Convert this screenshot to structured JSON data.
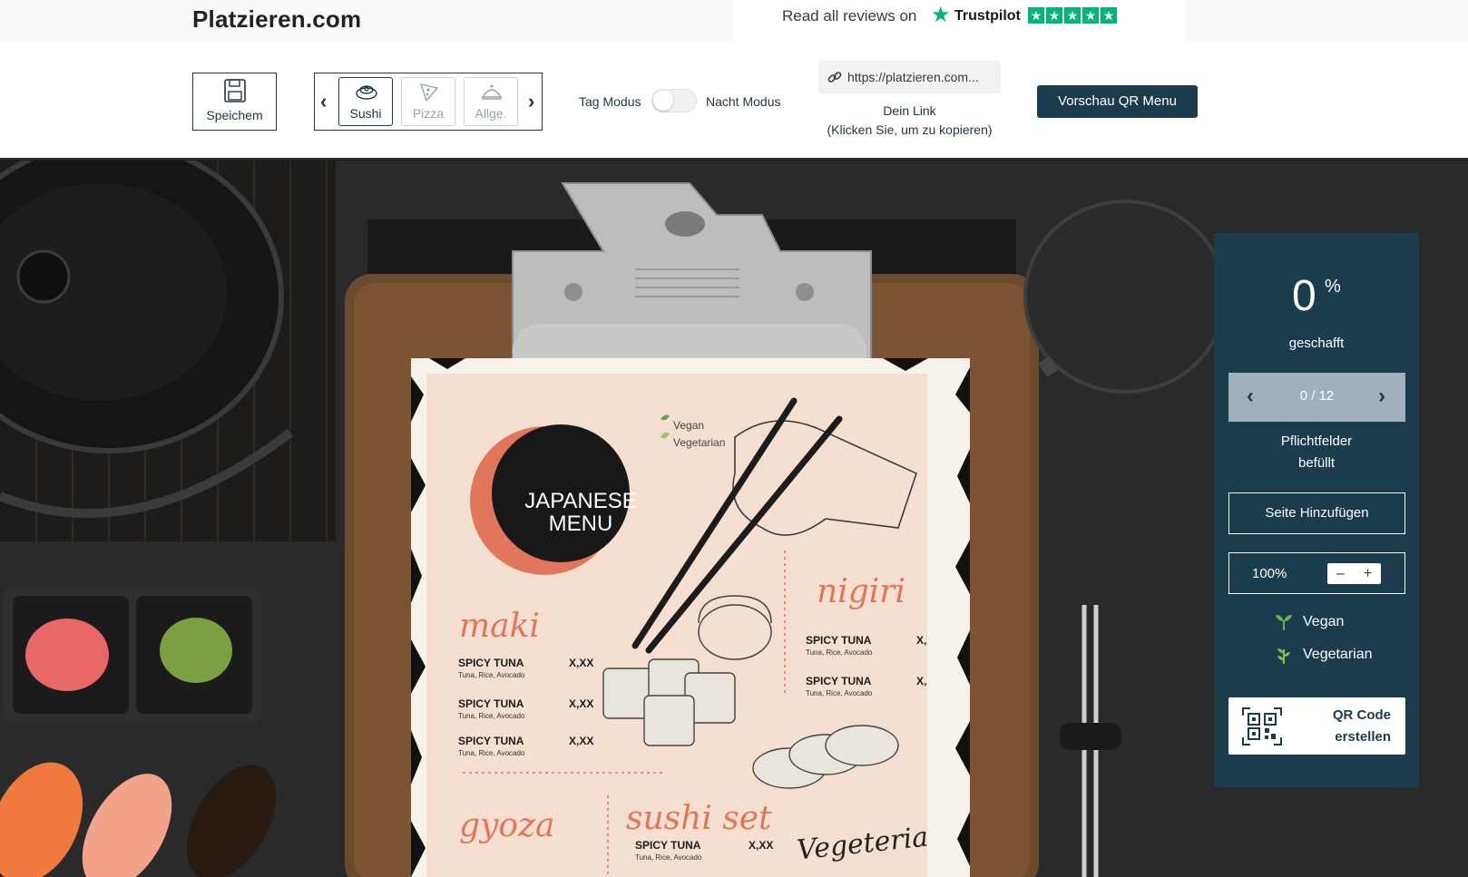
{
  "brand": "Platzieren.com",
  "reviews": {
    "text": "Read all reviews on",
    "provider": "Trustpilot",
    "stars": [
      "★",
      "★",
      "★",
      "★",
      "★"
    ]
  },
  "toolbar": {
    "save_label": "Speichem",
    "categories": [
      {
        "label": "Sushi",
        "active": true,
        "icon": "sushi-icon"
      },
      {
        "label": "Pizza",
        "active": false,
        "icon": "pizza-icon"
      },
      {
        "label": "Allge.",
        "active": false,
        "icon": "cloche-icon"
      }
    ],
    "mode_day": "Tag Modus",
    "mode_night": "Nacht Modus",
    "link_url": "https://platzieren.com...",
    "link_caption": "Dein Link",
    "link_hint": "(Klicken Sie, um zu kopieren)",
    "preview_label": "Vorschau QR Menu"
  },
  "menu": {
    "title_line1": "JAPANESE",
    "title_line2": "MENU",
    "legend_vegan": "Vegan",
    "legend_vegetarian": "Vegetarian",
    "sections": {
      "maki": "maki",
      "nigiri": "nigiri",
      "gyoza": "gyoza",
      "sushi_set": "sushi set",
      "vegetarian": "Vegeterian"
    },
    "item_name": "SPICY TUNA",
    "item_desc": "Tuna, Rice, Avocado",
    "item_price": "X,XX"
  },
  "panel": {
    "percent": "0",
    "percent_symbol": "%",
    "progress_label": "geschafft",
    "pager": "0 / 12",
    "required_line1": "Pflichtfelder",
    "required_line2": "befüllt",
    "add_page": "Seite Hinzufügen",
    "zoom": "100%",
    "zoom_minus": "–",
    "zoom_plus": "+",
    "legend_vegan": "Vegan",
    "legend_vegetarian": "Vegetarian",
    "qr_line1": "QR Code",
    "qr_line2": "erstellen"
  },
  "colors": {
    "panel": "#1b3c4d",
    "accent_salmon": "#e2765c",
    "trustpilot": "#00b67a",
    "paper": "#f4dfd0"
  }
}
